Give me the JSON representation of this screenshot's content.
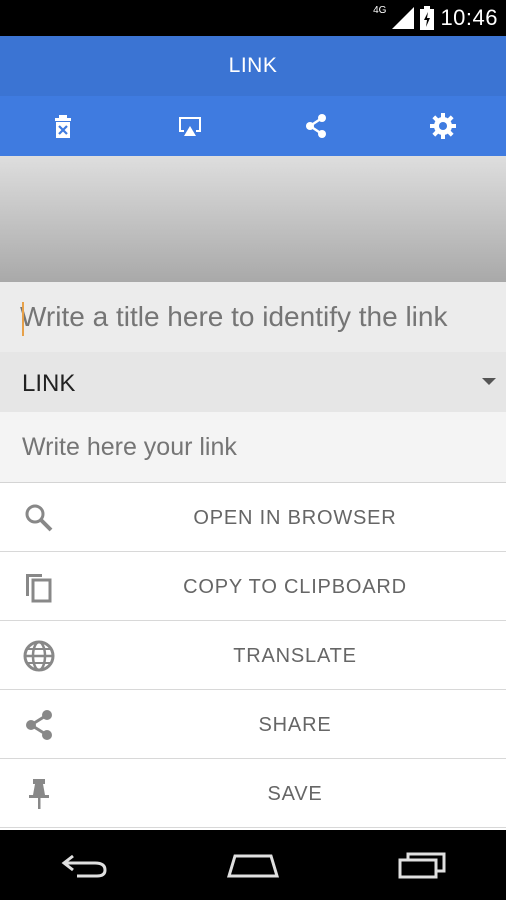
{
  "status_bar": {
    "network": "4G",
    "time": "10:46"
  },
  "header": {
    "title": "LINK"
  },
  "toolbar": {
    "icons": [
      "delete-icon",
      "cast-icon",
      "share-icon",
      "gear-icon"
    ],
    "accent": "#3f7be0",
    "title_bg": "#3b74d3"
  },
  "form": {
    "title_placeholder": "Write a title here to identify the link",
    "type_value": "LINK",
    "link_placeholder": "Write here your link"
  },
  "actions": [
    {
      "label": "OPEN IN BROWSER",
      "icon": "search-icon"
    },
    {
      "label": "COPY TO CLIPBOARD",
      "icon": "copy-icon"
    },
    {
      "label": "TRANSLATE",
      "icon": "globe-icon"
    },
    {
      "label": "SHARE",
      "icon": "share-icon"
    },
    {
      "label": "SAVE",
      "icon": "pin-icon"
    }
  ]
}
